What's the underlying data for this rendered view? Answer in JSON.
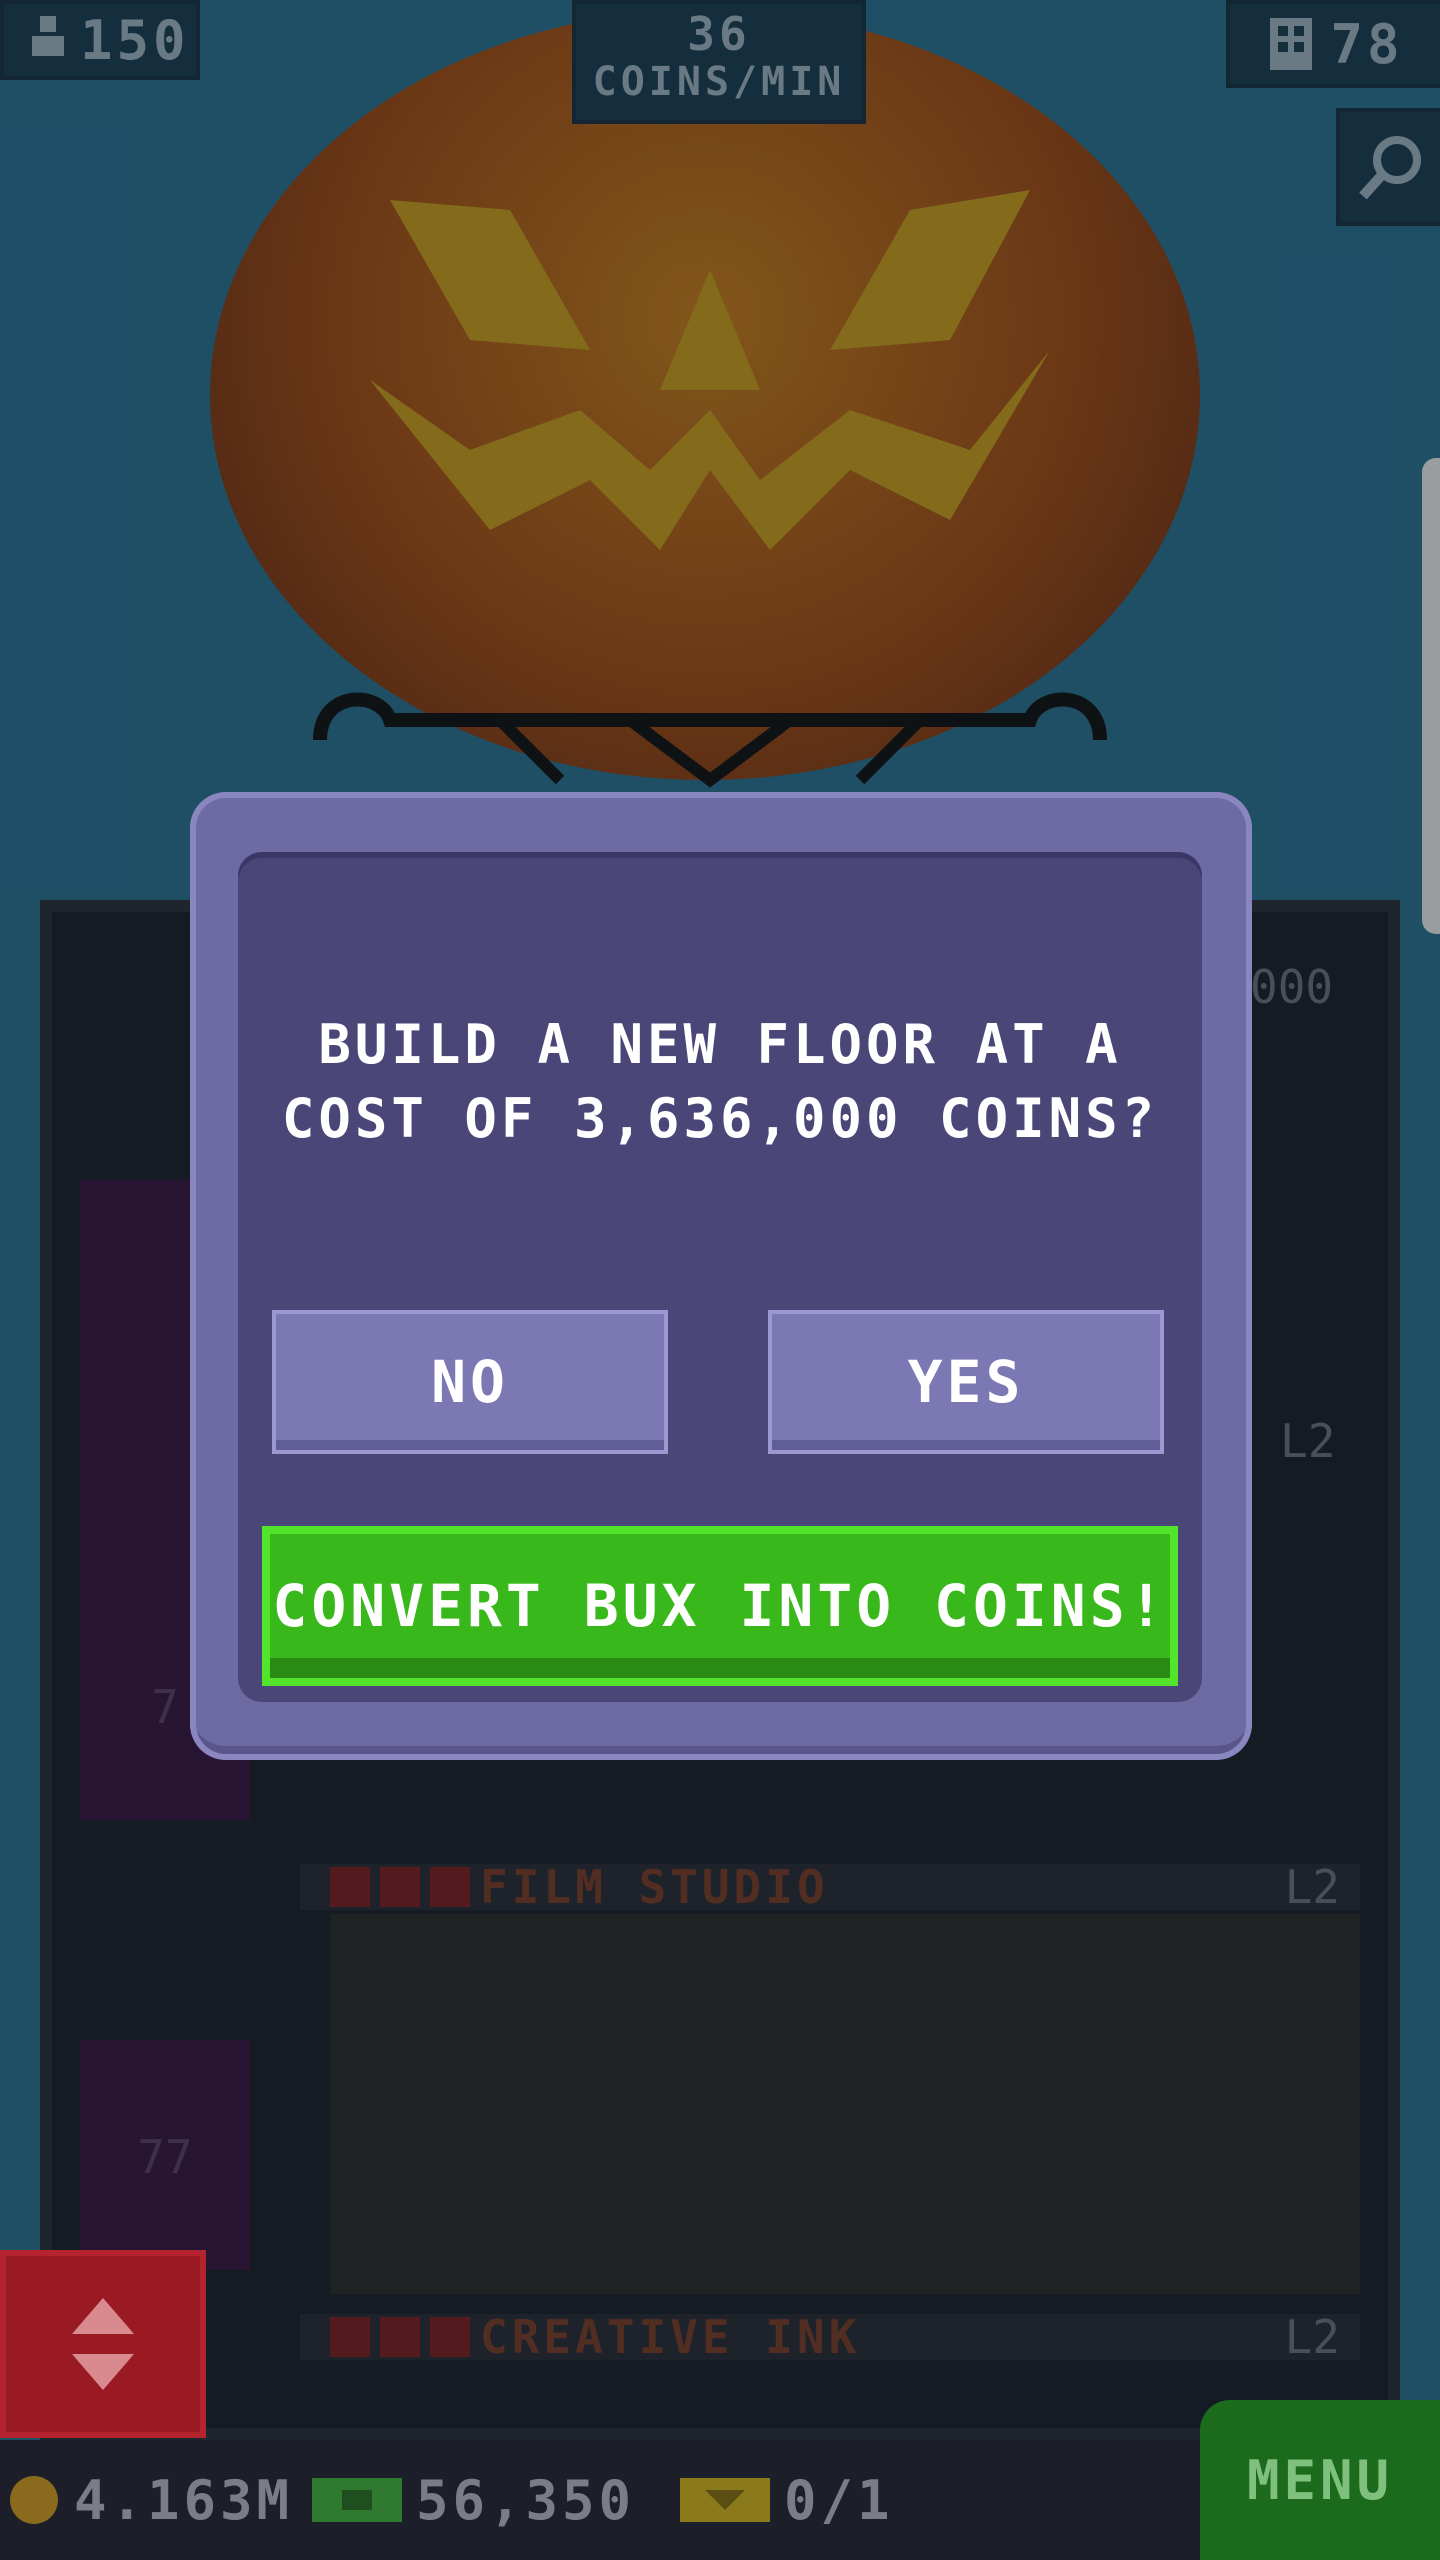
{
  "hud": {
    "population": "150",
    "coins_per_min_value": "36",
    "coins_per_min_unit": "COINS/MIN",
    "floors": "78"
  },
  "tower": {
    "floor_labels": [
      {
        "name": "FILM STUDIO",
        "level": "L2"
      },
      {
        "name": "CREATIVE INK",
        "level": "L2"
      }
    ],
    "level_tag_top": "L2",
    "partial_number": "000",
    "side_number": "77",
    "side_number_top": "7"
  },
  "dialog": {
    "prompt_line1": "BUILD A NEW FLOOR AT A",
    "prompt_line2": "COST OF 3,636,000 COINS?",
    "no_label": "NO",
    "yes_label": "YES",
    "convert_label": "CONVERT BUX INTO COINS!"
  },
  "bottom": {
    "coins": "4.163M",
    "bux": "56,350",
    "tickets": "0/1",
    "menu_label": "MENU"
  },
  "icons": [
    "person-icon",
    "building-icon",
    "magnify-icon",
    "coin-icon",
    "bux-icon",
    "ticket-icon",
    "elevator-arrows-icon",
    "x-icon"
  ],
  "colors": {
    "sky": "#2b6f8c",
    "dialog": "#6e6aa3",
    "dialog_inner": "#4a4677",
    "button": "#7c78b3",
    "convert": "#38b81b",
    "menu": "#1c6b1c",
    "elevator": "#9a1a24"
  }
}
